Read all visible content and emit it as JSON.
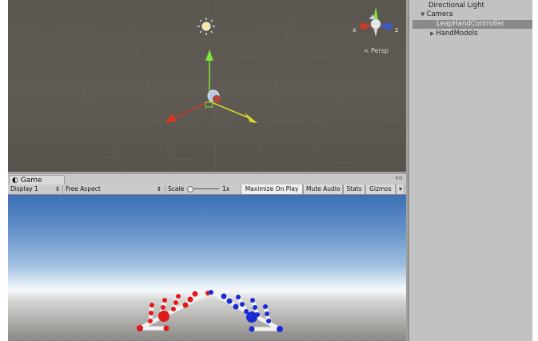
{
  "scene_view": {
    "persp_label": "Persp",
    "gizmo_axis_x": "x",
    "gizmo_axis_z": "z"
  },
  "hierarchy": {
    "items": [
      {
        "label": "Directional Light",
        "icon": "none"
      },
      {
        "label": "Camera",
        "icon": "expanded-arrow-icon"
      },
      {
        "label": "LeapHandController",
        "icon": "none",
        "selected": true
      },
      {
        "label": "HandModels",
        "icon": "collapsed-arrow-icon"
      }
    ]
  },
  "game_view": {
    "tab_label": "Game",
    "display": "Display 1",
    "aspect": "Free Aspect",
    "scale_label": "Scale",
    "scale_value": "1x",
    "maximize_on_play": "Maximize On Play",
    "mute_audio": "Mute Audio",
    "stats": "Stats",
    "gizmos": "Gizmos",
    "dropdown_arrow": "▾",
    "updown_arrow": "⇕"
  },
  "colors": {
    "left_hand": "#e01a1a",
    "right_hand": "#1a2bd6",
    "bones": "#f2f2f2",
    "selected_row": "#8a8a8a"
  }
}
